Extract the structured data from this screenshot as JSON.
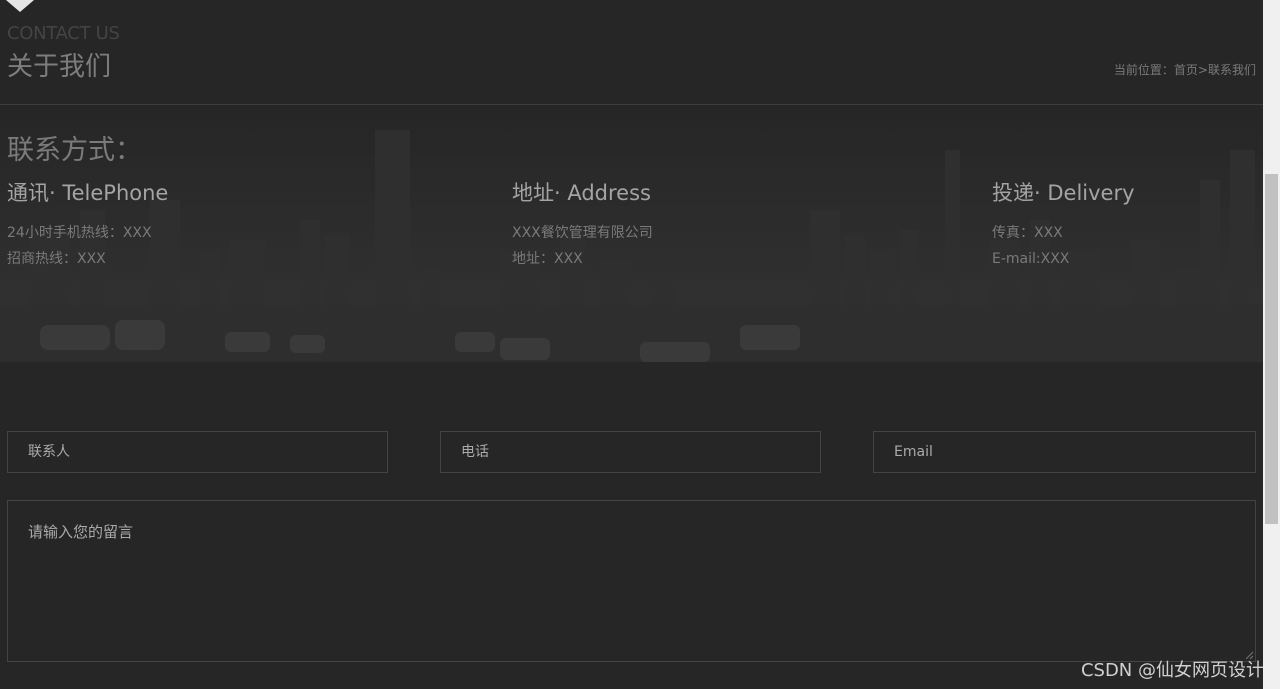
{
  "header": {
    "en_title": "CONTACT US",
    "cn_title": "关于我们",
    "breadcrumb": {
      "prefix": "当前位置：",
      "home": "首页",
      "separator": ">",
      "current": "联系我们"
    }
  },
  "contact": {
    "heading": "联系方式：",
    "columns": [
      {
        "title": "通讯· TelePhone",
        "lines": [
          "24小时手机热线：XXX",
          "招商热线：XXX"
        ]
      },
      {
        "title": "地址· Address",
        "lines": [
          "XXX餐饮管理有限公司",
          "地址：XXX"
        ]
      },
      {
        "title": "投递· Delivery",
        "lines": [
          "传真：XXX",
          "E-mail:XXX"
        ]
      }
    ]
  },
  "form": {
    "name_placeholder": "联系人",
    "phone_placeholder": "电话",
    "email_placeholder": "Email",
    "message_placeholder": "请输入您的留言"
  },
  "watermark": "CSDN @仙女网页设计"
}
